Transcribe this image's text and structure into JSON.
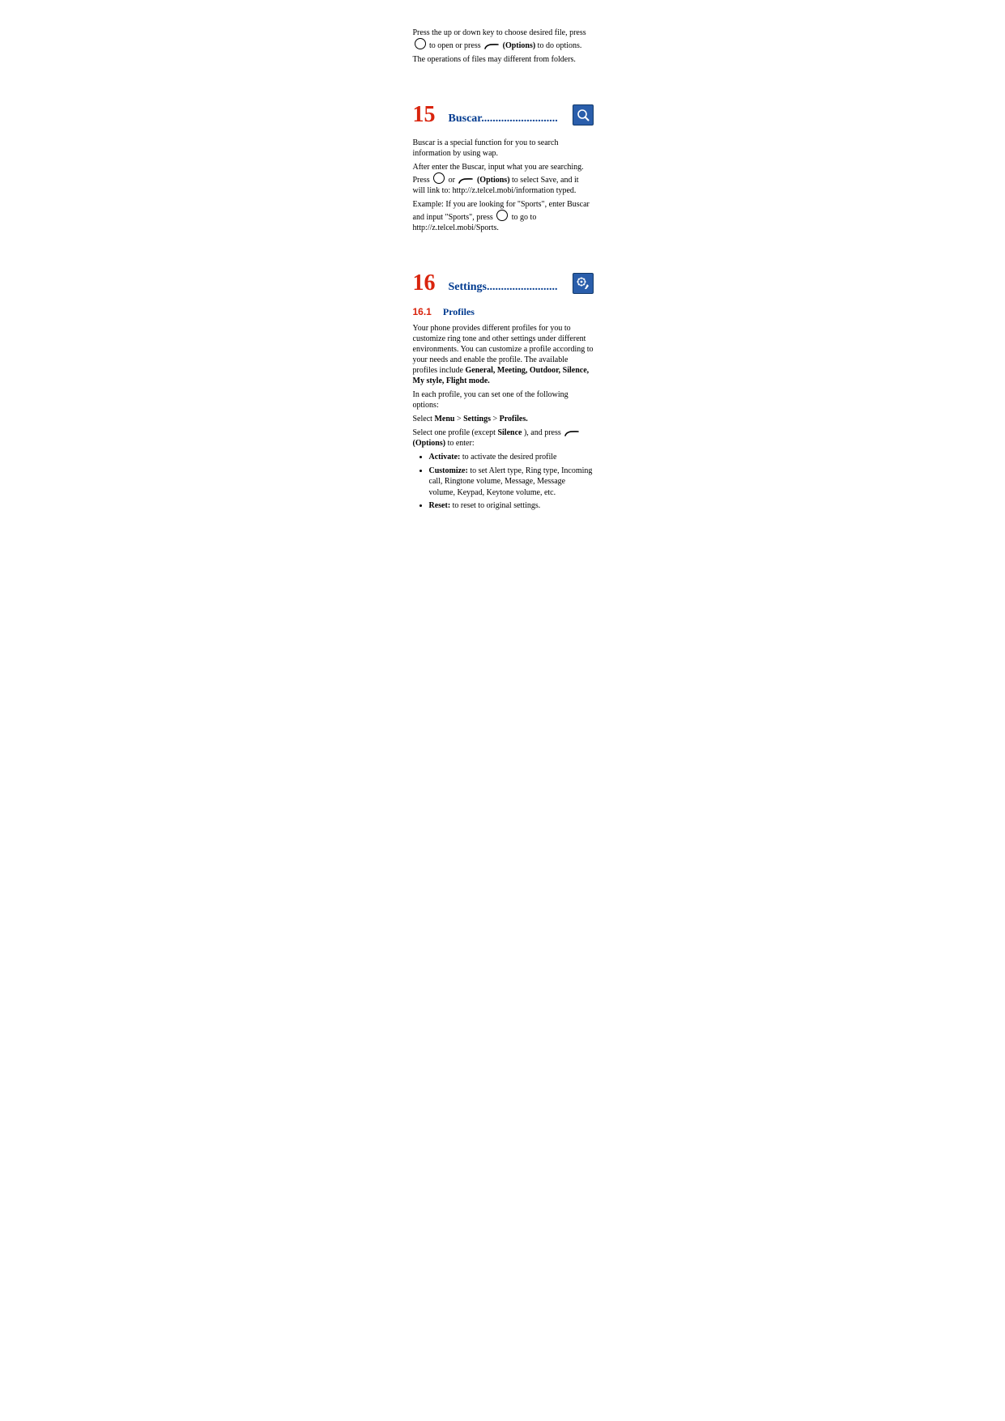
{
  "intro": {
    "line1a": "Press the up or down key to choose desired file, press ",
    "line1b": " to open or press ",
    "line1c_bold": "(Options)",
    "line1d": " to do options.",
    "line2": "The operations of files may different from folders."
  },
  "ch15": {
    "num": "15",
    "title": "Buscar...........................",
    "p1": "Buscar is a special function for you to search information by using wap.",
    "p2a": "After enter the Buscar, input what you are searching. Press ",
    "p2b": " or ",
    "p2c_bold": "(Options)",
    "p2d": " to select Save, and it will link to: http://z.telcel.mobi/information typed.",
    "p3a": "Example: If you are looking for \"Sports\", enter Buscar and input \"Sports\", press ",
    "p3b": " to go to http://z.telcel.mobi/Sports."
  },
  "ch16": {
    "num": "16",
    "title": "Settings.........................",
    "sub_num": "16.1",
    "sub_title": "Profiles",
    "p1a": "Your phone provides different profiles for you to customize ring tone and other settings under different environments. You can customize a profile according to your needs and enable the profile. The available profiles include ",
    "p1b_bold": "General, Meeting, Outdoor, Silence, My style, Flight mode.",
    "p2": "In each profile, you can set one of the following options:",
    "p3a": "Select ",
    "p3b_bold": "Menu",
    "p3c": " > ",
    "p3d_bold": "Settings",
    "p3e": " > ",
    "p3f_bold": "Profiles.",
    "p4a": "Select one profile (except ",
    "p4b_bold": "Silence",
    "p4c": "), and press ",
    "p4d_bold": "(Options)",
    "p4e": " to enter:",
    "bullets": {
      "b1a_bold": "Activate:",
      "b1b": " to activate the desired profile",
      "b2a_bold": "Customize:",
      "b2b": " to set Alert type, Ring type, Incoming call, Ringtone volume, Message, Message volume, Keypad, Keytone volume, etc.",
      "b3a_bold": "Reset:",
      "b3b": " to reset to original settings."
    }
  }
}
